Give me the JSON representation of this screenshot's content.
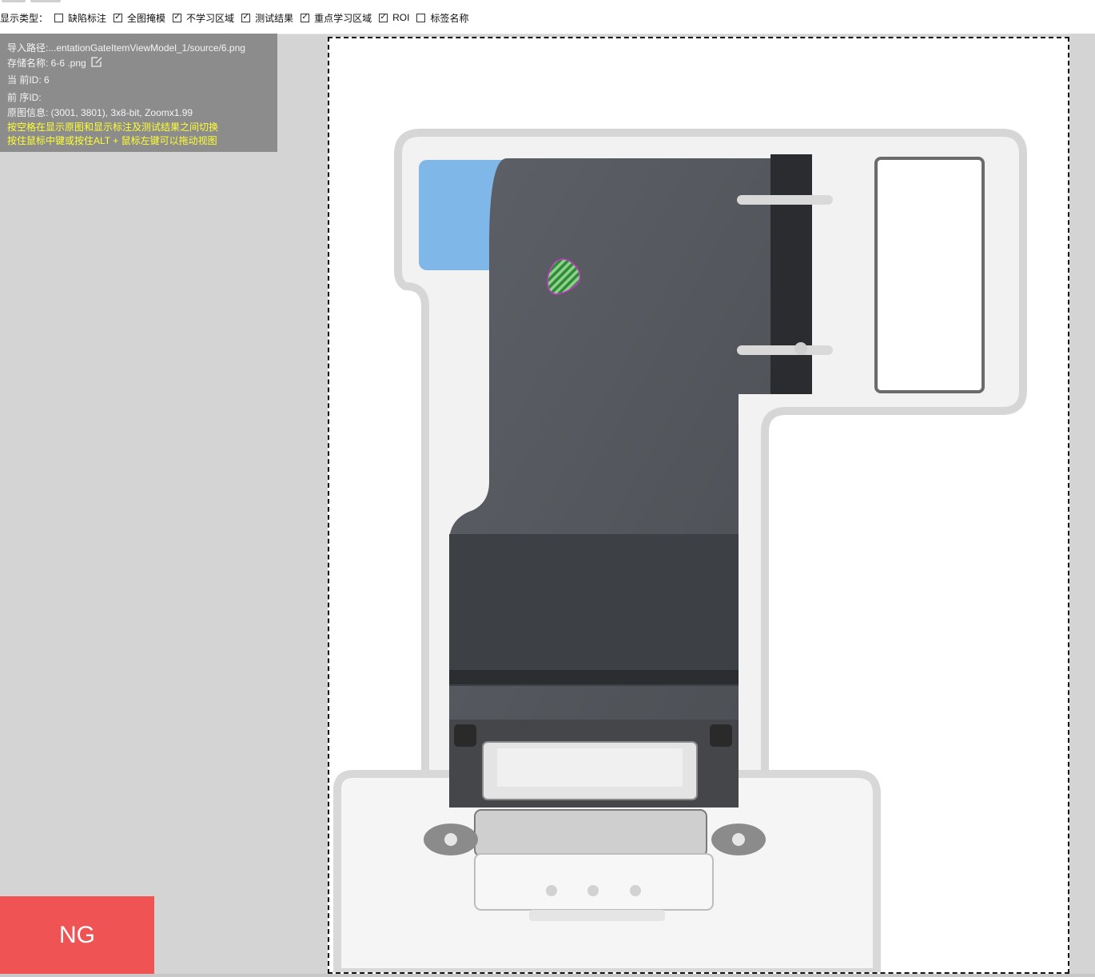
{
  "toolbar": {
    "display_type_label": "显示类型：",
    "filters": [
      {
        "label": "缺陷标注",
        "checked": false
      },
      {
        "label": "全图掩模",
        "checked": true
      },
      {
        "label": "不学习区域",
        "checked": true
      },
      {
        "label": "测试结果",
        "checked": true
      },
      {
        "label": "重点学习区域",
        "checked": true
      },
      {
        "label": "ROI",
        "checked": true
      },
      {
        "label": "标签名称",
        "checked": false
      }
    ]
  },
  "info": {
    "import_path": "导入路径:...entationGateItemViewModel_1/source/6.png",
    "storage_name": "存储名称: 6-6  .png",
    "current_id": "当 前ID: 6",
    "previous_id": "前 序ID:",
    "image_info": "原图信息: (3001, 3801), 3x8-bit, Zoomx1.99",
    "hint_space": "按空格在显示原图和显示标注及测试结果之间切换",
    "hint_drag": "按住鼠标中键或按住ALT + 鼠标左键可以拖动视图"
  },
  "result": {
    "status": "NG",
    "status_color": "#f05353"
  },
  "colors": {
    "panel_bg": "#8c8c8c",
    "hint_text": "#ffff33",
    "defect_outline": "#cc33cc",
    "defect_fill": "#2e8b3a"
  }
}
